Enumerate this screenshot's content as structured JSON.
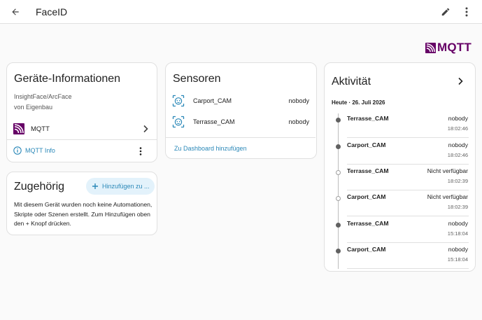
{
  "header": {
    "title": "FaceID"
  },
  "brand": {
    "logo_text": "MQTT",
    "color": "#660066"
  },
  "device_info": {
    "title": "Geräte-Informationen",
    "model": "InsightFace/ArcFace",
    "manufacturer": "von Eigenbau",
    "integration": {
      "label": "MQTT",
      "icon": "mqtt-icon"
    },
    "info_link": "MQTT Info"
  },
  "related": {
    "title": "Zugehörig",
    "add_button": "Hinzufügen zu ...",
    "text": "Mit diesem Gerät wurden noch keine Automationen, Skripte oder Szenen erstellt. Zum Hinzufügen oben den + Knopf drücken."
  },
  "sensors": {
    "title": "Sensoren",
    "items": [
      {
        "name": "Carport_CAM",
        "state": "nobody",
        "icon": "face-recognition-icon"
      },
      {
        "name": "Terrasse_CAM",
        "state": "nobody",
        "icon": "face-recognition-icon"
      }
    ],
    "dashboard_link": "Zu Dashboard hinzufügen"
  },
  "activity": {
    "title": "Aktivität",
    "date": "Heute · 26. Juli 2026",
    "items": [
      {
        "name": "Terrasse_CAM",
        "state": "nobody",
        "time": "18:02:46",
        "dot": "filled"
      },
      {
        "name": "Carport_CAM",
        "state": "nobody",
        "time": "18:02:46",
        "dot": "filled"
      },
      {
        "name": "Terrasse_CAM",
        "state": "Nicht verfügbar",
        "time": "18:02:39",
        "dot": "hollow"
      },
      {
        "name": "Carport_CAM",
        "state": "Nicht verfügbar",
        "time": "18:02:39",
        "dot": "hollow"
      },
      {
        "name": "Terrasse_CAM",
        "state": "nobody",
        "time": "15:18:04",
        "dot": "filled"
      },
      {
        "name": "Carport_CAM",
        "state": "nobody",
        "time": "15:18:04",
        "dot": "filled"
      }
    ]
  },
  "colors": {
    "accent": "#2a88b8",
    "mqtt": "#660066",
    "background": "#fafafa"
  }
}
